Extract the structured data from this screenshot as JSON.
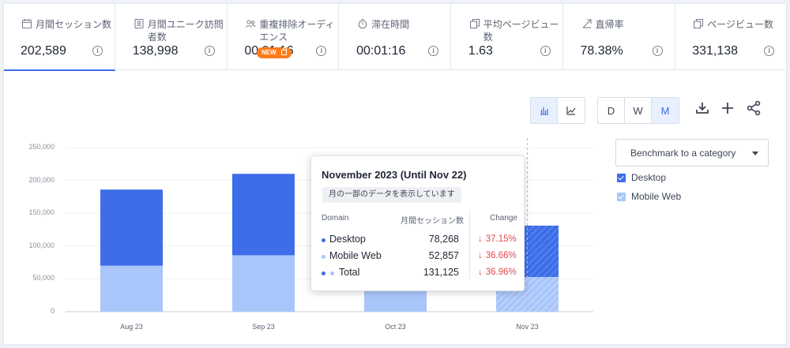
{
  "metrics": [
    {
      "label": "月間セッション数",
      "value": "202,589",
      "icon": "calendar-icon",
      "active": true
    },
    {
      "label": "月間ユニーク訪問者数",
      "value": "138,998",
      "icon": "id-card-icon",
      "active": false
    },
    {
      "label": "重複排除オーディエンス",
      "value": "00:01:16",
      "icon": "users-icon",
      "active": false,
      "badge": "NEW"
    },
    {
      "label": "滞在時間",
      "value": "00:01:16",
      "icon": "stopwatch-icon",
      "active": false
    },
    {
      "label": "平均ページビュー数",
      "value": "1.63",
      "icon": "pages-icon",
      "active": false
    },
    {
      "label": "直帰率",
      "value": "78.38%",
      "icon": "bounce-icon",
      "active": false
    },
    {
      "label": "ページビュー数",
      "value": "331,138",
      "icon": "pageviews-icon",
      "active": false
    }
  ],
  "toolbar": {
    "period_buttons": [
      "D",
      "W",
      "M"
    ],
    "selected_period": "M",
    "chart_type_selected": "bar"
  },
  "benchmark": {
    "label": "Benchmark to a category"
  },
  "legend": [
    {
      "name": "Desktop",
      "color": "#3d6de8"
    },
    {
      "name": "Mobile Web",
      "color": "#a9c6fa"
    }
  ],
  "chart_data": {
    "type": "bar",
    "stacked": true,
    "categories": [
      "Aug 23",
      "Sep 23",
      "Oct 23",
      "Nov 23"
    ],
    "series": [
      {
        "name": "Mobile Web",
        "values": [
          70000,
          86000,
          52000,
          52857
        ],
        "color": "#a9c6fa"
      },
      {
        "name": "Desktop",
        "values": [
          116000,
          124000,
          0,
          78268
        ],
        "color": "#3d6de8"
      }
    ],
    "partial_last_category": true,
    "ylim": [
      0,
      250000
    ],
    "yticks": [
      "0",
      "50,000",
      "100,000",
      "150,000",
      "200,000",
      "250,000"
    ],
    "grid": true
  },
  "tooltip": {
    "title": "November 2023 (Until Nov 22)",
    "note": "月の一部のデータを表示しています",
    "col_domain": "Domain",
    "col_metric": "月間セッション数",
    "col_change": "Change",
    "rows": [
      {
        "name": "Desktop",
        "value": "78,268",
        "change": "37.15%",
        "dot": "#3d6de8"
      },
      {
        "name": "Mobile Web",
        "value": "52,857",
        "change": "36.66%",
        "dot": "#a9c6fa"
      },
      {
        "name": "Total",
        "value": "131,125",
        "change": "36.96%",
        "dot": "both"
      }
    ]
  },
  "colors": {
    "accent": "#3d6de8",
    "negative": "#e5484d",
    "badge": "#ff7a1a"
  }
}
